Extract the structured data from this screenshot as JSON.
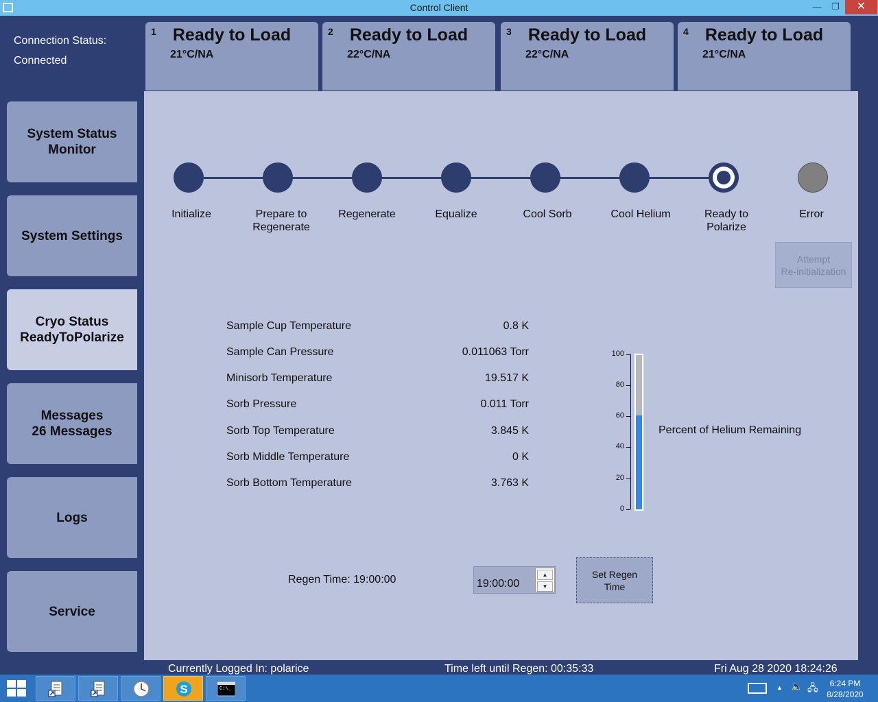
{
  "window": {
    "title": "Control Client",
    "minimize_glyph": "—",
    "maximize_glyph": "❐",
    "close_glyph": "✕"
  },
  "connection": {
    "label": "Connection Status:",
    "value": "Connected"
  },
  "load_tabs": [
    {
      "number": "1",
      "status": "Ready to Load",
      "temp": "21°C/NA"
    },
    {
      "number": "2",
      "status": "Ready to Load",
      "temp": "22°C/NA"
    },
    {
      "number": "3",
      "status": "Ready to Load",
      "temp": "22°C/NA"
    },
    {
      "number": "4",
      "status": "Ready to Load",
      "temp": "21°C/NA"
    }
  ],
  "sidebar": {
    "items": [
      {
        "line1": "System Status",
        "line2": "Monitor"
      },
      {
        "line1": "System Settings",
        "line2": ""
      },
      {
        "line1": "Cryo Status",
        "line2": "ReadyToPolarize"
      },
      {
        "line1": "Messages",
        "line2": "26 Messages"
      },
      {
        "line1": "Logs",
        "line2": ""
      },
      {
        "line1": "Service",
        "line2": ""
      }
    ],
    "active_index": 2
  },
  "states": [
    {
      "line1": "Initialize",
      "line2": ""
    },
    {
      "line1": "Prepare to",
      "line2": "Regenerate"
    },
    {
      "line1": "Regenerate",
      "line2": ""
    },
    {
      "line1": "Equalize",
      "line2": ""
    },
    {
      "line1": "Cool Sorb",
      "line2": ""
    },
    {
      "line1": "Cool Helium",
      "line2": ""
    },
    {
      "line1": "Ready to",
      "line2": "Polarize"
    },
    {
      "line1": "Error",
      "line2": ""
    }
  ],
  "current_state_index": 6,
  "reinit_button": {
    "line1": "Attempt",
    "line2": "Re-initialization",
    "enabled": false
  },
  "readings": [
    {
      "label": "Sample Cup Temperature",
      "value": "0.8 K"
    },
    {
      "label": "Sample Can Pressure",
      "value": "0.011063 Torr"
    },
    {
      "label": "Minisorb Temperature",
      "value": "19.517 K"
    },
    {
      "label": "Sorb Pressure",
      "value": "0.011 Torr"
    },
    {
      "label": "Sorb Top Temperature",
      "value": "3.845 K"
    },
    {
      "label": "Sorb Middle Temperature",
      "value": "0 K"
    },
    {
      "label": "Sorb Bottom Temperature",
      "value": "3.763 K"
    }
  ],
  "helium_gauge": {
    "label": "Percent of Helium Remaining",
    "ticks": [
      "100",
      "80",
      "60",
      "40",
      "20",
      "0"
    ],
    "percent": 61,
    "fill_color": "#2f8af0"
  },
  "regen": {
    "text": "Regen Time: 19:00:00",
    "input_value": "19:00:00",
    "spin_up": "▲",
    "spin_down": "▼",
    "set_button": {
      "line1": "Set Regen",
      "line2": "Time"
    }
  },
  "status_bar": {
    "logged_in": "Currently Logged In: polarice",
    "time_left": "Time left until Regen: 00:35:33",
    "datetime": "Fri Aug 28 2020 18:24:26"
  },
  "taskbar": {
    "tray": {
      "up_arrow": "▲",
      "speaker": "🔈",
      "network": "🖧"
    },
    "clock_time": "6:24 PM",
    "clock_date": "8/28/2020",
    "apps": [
      "document-shortcut-icon",
      "document-shortcut-icon",
      "clock-app-icon",
      "skype-icon",
      "command-prompt-icon"
    ]
  }
}
